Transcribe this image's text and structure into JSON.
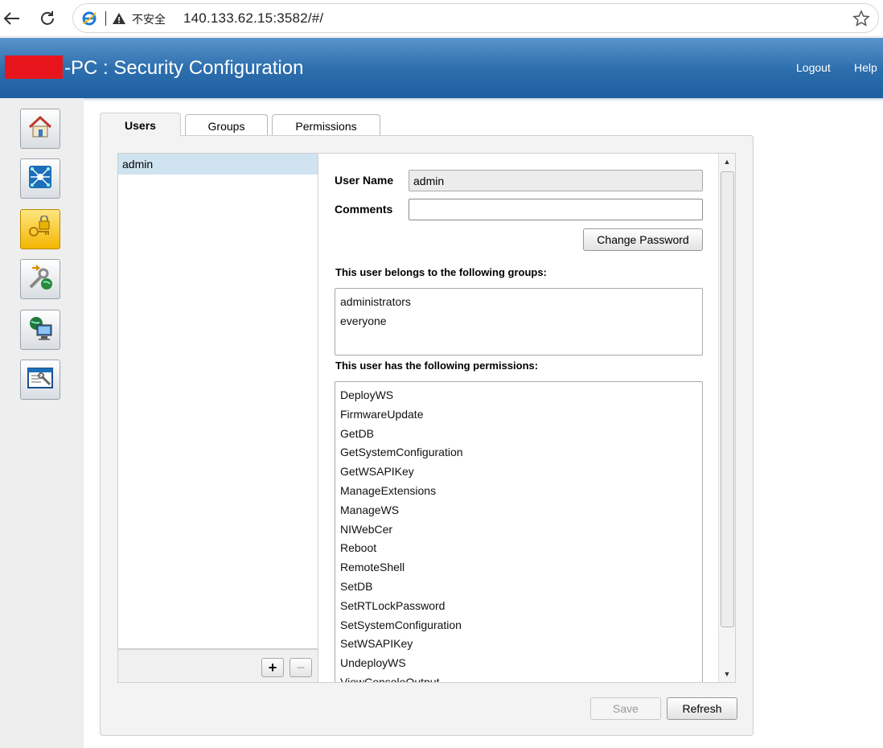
{
  "browser": {
    "insecure_label": "不安全",
    "url": "140.133.62.15:3582/#/"
  },
  "header": {
    "title": "-PC : Security Configuration",
    "logout": "Logout",
    "help": "Help",
    "background_color": "#2e6fae"
  },
  "sidebar": {
    "items": [
      {
        "icon": "home-icon"
      },
      {
        "icon": "network-icon"
      },
      {
        "icon": "security-lock-icon",
        "active": true
      },
      {
        "icon": "software-tools-icon"
      },
      {
        "icon": "web-server-icon"
      },
      {
        "icon": "console-settings-icon"
      }
    ]
  },
  "tabs": [
    {
      "label": "Users",
      "active": true
    },
    {
      "label": "Groups"
    },
    {
      "label": "Permissions"
    }
  ],
  "users": {
    "list": [
      "admin"
    ],
    "selected": "admin",
    "add_label": "+",
    "remove_label": "−"
  },
  "detail": {
    "username_label": "User Name",
    "username_value": "admin",
    "comments_label": "Comments",
    "comments_value": "",
    "change_password": "Change Password",
    "groups_heading": "This user belongs to the following groups:",
    "groups": [
      "administrators",
      "everyone"
    ],
    "perms_heading": "This user has the following permissions:",
    "permissions": [
      "DeployWS",
      "FirmwareUpdate",
      "GetDB",
      "GetSystemConfiguration",
      "GetWSAPIKey",
      "ManageExtensions",
      "ManageWS",
      "NIWebCer",
      "Reboot",
      "RemoteShell",
      "SetDB",
      "SetRTLockPassword",
      "SetSystemConfiguration",
      "SetWSAPIKey",
      "UndeployWS",
      "ViewConsoleOutput"
    ]
  },
  "actions": {
    "save": "Save",
    "refresh": "Refresh"
  }
}
